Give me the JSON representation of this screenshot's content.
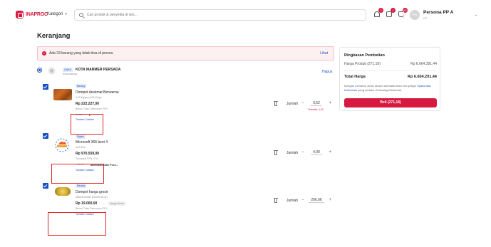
{
  "header": {
    "logo_text": "INAPROC",
    "kategori_label": "Kategori",
    "search_placeholder": "Cari produk & penyedia di sini...",
    "icons": [
      {
        "name": "bell-icon",
        "badge": "2"
      },
      {
        "name": "mail-icon",
        "badge": "1"
      },
      {
        "name": "cart-icon",
        "badge": "33"
      }
    ],
    "user": {
      "initials": "PPA",
      "name": "Persona PP A",
      "role": "PP"
    }
  },
  "page": {
    "title": "Keranjang",
    "alert": {
      "text": "Ada 33 barang yang tidak bisa di proses.",
      "link": "Lihat"
    }
  },
  "vendor": {
    "tag": "UMKK",
    "name": "KOTA MARMER PERSADA",
    "location": "Kota Malang",
    "delete_label": "Hapus"
  },
  "items": [
    {
      "tag": "Barang",
      "name": "Dompet deskmat Berwarna",
      "sub": "0,22 Kg/pcs (194,00 gr)",
      "price": "Rp 222.227,00",
      "tax": "Belum Tidak Dikenakan PPN",
      "catatan_label": "Tambah Catatan",
      "qty_label": "Jumlah",
      "qty": "0,52",
      "warn": "Tersedia: 1,00",
      "variant_label": "Varian",
      "variant_value": "L"
    },
    {
      "tag": "Digital",
      "name": "Microsoft 365 best 4",
      "sub": "4,00 Pcs",
      "price": "Rp 970.559,00",
      "tax": "Termasuk PPN 11%",
      "catatan_label": "Tambah Catatan",
      "qty_label": "Jumlah",
      "qty": "4,00",
      "variant_label": "Varian",
      "variant_value": "Microsoft 365 Pers..."
    },
    {
      "tag": "Barang",
      "name": "Dompet harga grosir",
      "sub": "266,66 Amber (28.000,00 gr)",
      "price": "Rp 19.000,00",
      "grosir": "Harga Grosir",
      "tax": "Belum Tidak Dikenakan PPN",
      "catatan_label": "Tambah Catatan",
      "qty_label": "Jumlah",
      "qty": "266,66"
    }
  ],
  "summary": {
    "title": "Ringkasan Pembelian",
    "subtotal_label": "Harga Produk (271,18)",
    "subtotal_value": "Rp 6.664.391,44",
    "total_label": "Total Harga",
    "total_value": "Rp 6.604.201,44",
    "note_pre": "Dengan membeli, Anda secara otomatis telah menyetujui",
    "note_link": "Syarat dan Ketentuan",
    "note_post": "yang berlaku di Katalog Elektronik.",
    "buy_label": "Beli (271,18)"
  },
  "colors": {
    "brand": "#d7193f",
    "link": "#1a4fc4",
    "alert_bg": "#fdf0f1"
  }
}
